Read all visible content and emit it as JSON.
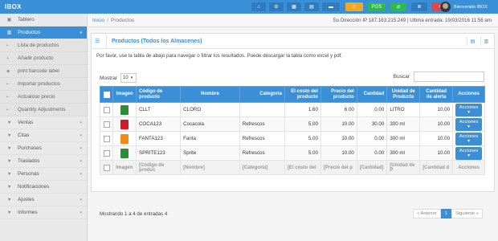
{
  "app": {
    "brand": "IBOX"
  },
  "topbar": {
    "buttons": [
      {
        "name": "home-icon",
        "glyph": "⌂",
        "color": "#3a8fd6"
      },
      {
        "name": "cogs-icon",
        "glyph": "⚙",
        "color": "#3a8fd6"
      },
      {
        "name": "calendar-icon",
        "glyph": "▦",
        "color": "#3a8fd6"
      },
      {
        "name": "calculator-icon",
        "glyph": "▤",
        "color": "#3a8fd6"
      },
      {
        "name": "flag-icon",
        "glyph": "▬",
        "color": "#3a8fd6"
      },
      {
        "name": "warning-icon",
        "glyph": "⚠",
        "color": "#f5a623"
      },
      {
        "name": "pos-button",
        "glyph": "POS",
        "color": "#2eb84d"
      },
      {
        "name": "shuffle-icon",
        "glyph": "⇄",
        "color": "#2eb84d"
      },
      {
        "name": "list-icon",
        "glyph": "≣",
        "color": "#3a8fd6"
      },
      {
        "name": "gift-icon",
        "glyph": "✦",
        "color": "#e04848"
      }
    ],
    "user": "Bienvenido IBOX"
  },
  "sidebar": {
    "items": [
      {
        "label": "Tablero",
        "icon": "▣",
        "active": false,
        "chevron": false
      },
      {
        "label": "Productos",
        "icon": "▥",
        "active": true,
        "chevron": true
      },
      {
        "label": "Ventas",
        "icon": "♥",
        "active": false,
        "chevron": true
      },
      {
        "label": "Citas",
        "icon": "♥",
        "active": false,
        "chevron": true
      },
      {
        "label": "Purchases",
        "icon": "♥",
        "active": false,
        "chevron": true
      },
      {
        "label": "Traslados",
        "icon": "♥",
        "active": false,
        "chevron": true
      },
      {
        "label": "Personas",
        "icon": "♥",
        "active": false,
        "chevron": true
      },
      {
        "label": "Notificaciones",
        "icon": "♥",
        "active": false,
        "chevron": false
      },
      {
        "label": "Ajustes",
        "icon": "♥",
        "active": false,
        "chevron": true
      },
      {
        "label": "Informes",
        "icon": "♥",
        "active": false,
        "chevron": true
      }
    ],
    "subitems": [
      {
        "label": "Lista de productos",
        "icon": "▪"
      },
      {
        "label": "Añadir producto",
        "icon": "+"
      },
      {
        "label": "print barcode label",
        "icon": "◆"
      },
      {
        "label": "Importar productos",
        "icon": "▪"
      },
      {
        "label": "Actualizar precio",
        "icon": "▪"
      },
      {
        "label": "Quantity Adjustments",
        "icon": "▪"
      }
    ]
  },
  "breadcrumb": {
    "home": "Inicio",
    "current": "Productos"
  },
  "ip_info": "Su Dirección IP 187.163.215.249 | Ultima entrada: 19/03/2016 11:56 am",
  "panel": {
    "title": "Productos (Todos los Almacenes)",
    "intro": "Por favor, use la tabla de abajo para navegar o filtrar los resultados. Puede descargar la tabla como excel y pdf.",
    "show_label": "Mostrar",
    "show_value": "10",
    "search_label": "Buscar"
  },
  "table": {
    "headers": [
      "Imagen",
      "Código de producto",
      "Nombre",
      "Categoría",
      "El costo del producto",
      "Precio del producto",
      "Cantidad",
      "Unidad de Producto",
      "Cantidad de alerta",
      "Acciones"
    ],
    "rows": [
      {
        "img_color": "#2e8b3a",
        "code": "CLLT",
        "name": "CLORO",
        "category": "",
        "cost": "1.60",
        "price": "6.00",
        "qty": "0.00",
        "unit": "LITRO",
        "alert": "10.00",
        "action": "Acciones ▾"
      },
      {
        "img_color": "#c8202a",
        "code": "COCA123",
        "name": "Cocacola",
        "category": "Refrescos",
        "cost": "5.00",
        "price": "10.00",
        "qty": "30.00",
        "unit": "300 ml",
        "alert": "10.00",
        "action": "Acciones ▾"
      },
      {
        "img_color": "#f08a1c",
        "code": "FANTA123",
        "name": "Fanta",
        "category": "Refrescos",
        "cost": "5.00",
        "price": "10.00",
        "qty": "0.00",
        "unit": "300 ml",
        "alert": "10.00",
        "action": "Acciones ▾"
      },
      {
        "img_color": "#2f8a3e",
        "code": "SPRITE123",
        "name": "Sprite",
        "category": "Refrescos",
        "cost": "5.00",
        "price": "10.00",
        "qty": "0.00",
        "unit": "300 ml",
        "alert": "10.00",
        "action": "Acciones ▾"
      }
    ],
    "footer": [
      "Imagen",
      "[Código de produc",
      "[Nombre]",
      "[Categoría]",
      "[El costo del",
      "[Precio del p",
      "[Cantidad]",
      "[Unidad de P",
      "[Cantidad d",
      "Acciones"
    ]
  },
  "info": "Mostrando 1 a 4 de entradas 4",
  "pager": {
    "prev": "« Anterior",
    "current": "1",
    "next": "Siguiente »"
  }
}
